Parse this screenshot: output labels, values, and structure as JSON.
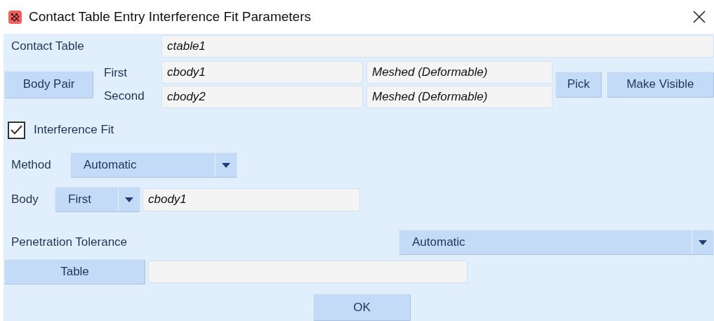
{
  "window": {
    "title": "Contact Table Entry Interference Fit Parameters"
  },
  "contact_table": {
    "label": "Contact Table",
    "value": "ctable1"
  },
  "body_pair": {
    "button": "Body Pair",
    "rows": [
      {
        "label": "First",
        "name": "cbody1",
        "type": "Meshed (Deformable)"
      },
      {
        "label": "Second",
        "name": "cbody2",
        "type": "Meshed (Deformable)"
      }
    ],
    "buttons": [
      "Pick",
      "Make Visible"
    ]
  },
  "interference_fit": {
    "label": "Interference Fit",
    "checked": true
  },
  "method": {
    "label": "Method",
    "value": "Automatic"
  },
  "body": {
    "label": "Body",
    "value": "First",
    "field": "cbody1"
  },
  "penetration_tolerance": {
    "label": "Penetration Tolerance",
    "value": "Automatic",
    "button": "Table"
  },
  "buttons": [
    "OK"
  ]
}
